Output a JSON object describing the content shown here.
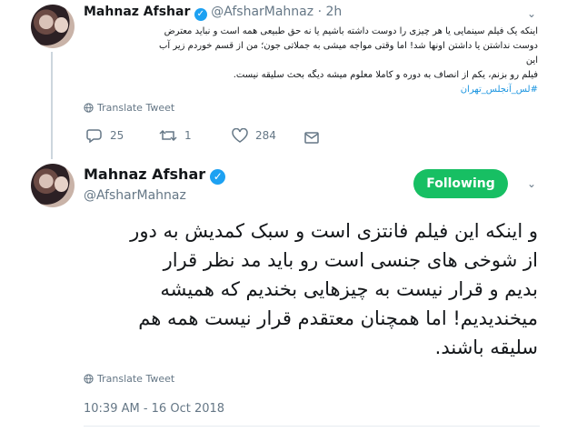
{
  "reply_tweet": {
    "display_name": "Mahnaz Afshar",
    "handle": "@AfsharMahnaz",
    "separator": "·",
    "time_ago": "2h",
    "text_lines": [
      "اینکه یک فیلم سینمایی یا هر چیزی را دوست داشته باشیم یا نه حق طبیعی همه است و نباید معترض",
      "دوست نداشتن یا داشتن اونها شد! اما وقتی مواجه میشی به جملاتی جون؛ من از قسم خوردم زیر آب این",
      "فیلم رو بزنم، یکم از انصاف به دوره و کاملا معلوم میشه دیگه بحث سلیقه نیست."
    ],
    "hashtag": "#لس_آنجلس_تهران",
    "translate_label": "Translate Tweet",
    "reply_count": "25",
    "retweet_count": "1",
    "like_count": "284"
  },
  "main_tweet": {
    "display_name": "Mahnaz Afshar",
    "handle": "@AfsharMahnaz",
    "follow_button": "Following",
    "text_lines": [
      "و اینکه این فیلم فانتزی است و سبک کمدیش به دور",
      "از شوخی های جنسی است رو باید مد نظر قرار",
      "بدیم و قرار نیست به چیزهایی بخندیم که همیشه",
      "میخندیدیم! اما همچنان معتقدم قرار نیست همه هم",
      "سلیقه باشند."
    ],
    "translate_label": "Translate Tweet",
    "timestamp": "10:39 AM - 16 Oct 2018"
  },
  "icons": {
    "verified": "verified-badge-icon",
    "chevron": "chevron-down-icon",
    "globe": "globe-icon",
    "reply": "reply-icon",
    "retweet": "retweet-icon",
    "like": "heart-icon",
    "message": "envelope-icon"
  },
  "colors": {
    "accent": "#1da1f2",
    "following_button": "#17bf63",
    "muted": "#657786",
    "hashtag": "#1b95e0"
  }
}
